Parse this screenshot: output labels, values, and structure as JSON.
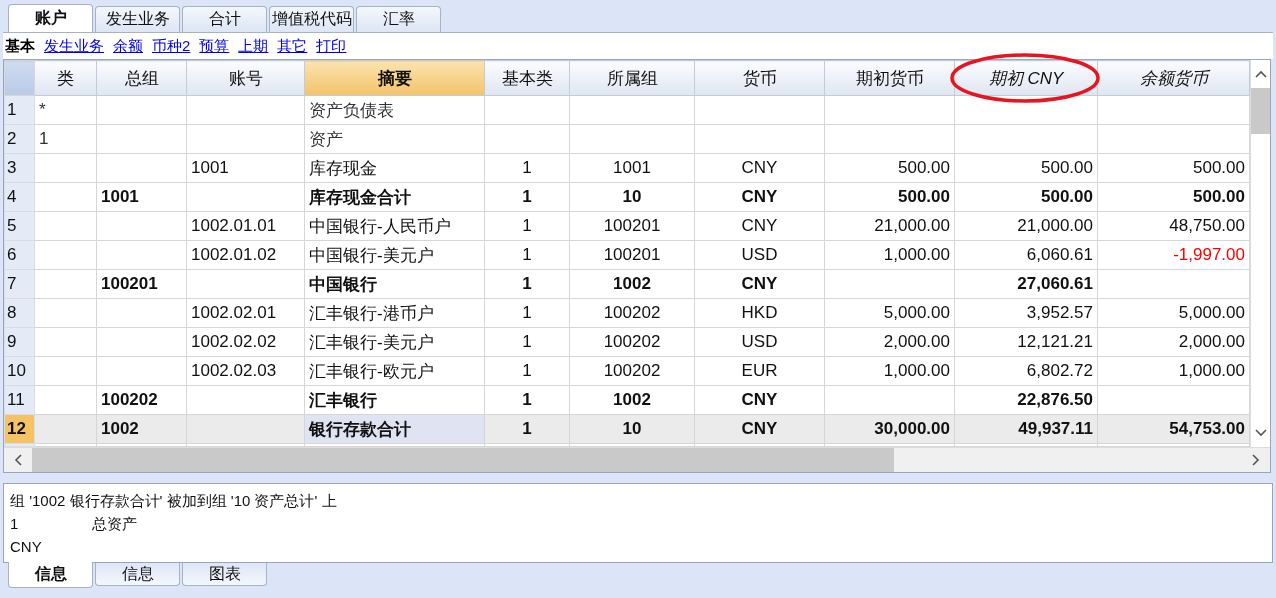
{
  "tabs": [
    {
      "label": "账户",
      "selected": true
    },
    {
      "label": "发生业务",
      "selected": false
    },
    {
      "label": "合计",
      "selected": false
    },
    {
      "label": "增值税代码",
      "selected": false
    },
    {
      "label": "汇率",
      "selected": false
    }
  ],
  "views": [
    {
      "label": "基本",
      "selected": true
    },
    {
      "label": "发生业务",
      "selected": false
    },
    {
      "label": "余额",
      "selected": false
    },
    {
      "label": "币种2",
      "selected": false
    },
    {
      "label": "预算",
      "selected": false
    },
    {
      "label": "上期",
      "selected": false
    },
    {
      "label": "其它",
      "selected": false
    },
    {
      "label": "打印",
      "selected": false
    }
  ],
  "table": {
    "columns": [
      {
        "label": "类",
        "selected": false,
        "italic": false,
        "circled": false
      },
      {
        "label": "总组",
        "selected": false,
        "italic": false,
        "circled": false
      },
      {
        "label": "账号",
        "selected": false,
        "italic": false,
        "circled": false
      },
      {
        "label": "摘要",
        "selected": true,
        "italic": false,
        "circled": false
      },
      {
        "label": "基本类",
        "selected": false,
        "italic": false,
        "circled": false
      },
      {
        "label": "所属组",
        "selected": false,
        "italic": false,
        "circled": false
      },
      {
        "label": "货币",
        "selected": false,
        "italic": false,
        "circled": false
      },
      {
        "label": "期初货币",
        "selected": false,
        "italic": false,
        "circled": false
      },
      {
        "label": "期初 CNY",
        "selected": false,
        "italic": true,
        "circled": true
      },
      {
        "label": "余额货币",
        "selected": false,
        "italic": true,
        "circled": false
      }
    ],
    "rows": [
      {
        "num": "1",
        "kind": "heading",
        "selected": false,
        "negative": false,
        "cells": [
          "*",
          "",
          "",
          "资产负债表",
          "",
          "",
          "",
          "",
          "",
          ""
        ]
      },
      {
        "num": "2",
        "kind": "heading",
        "selected": false,
        "negative": false,
        "cells": [
          "1",
          "",
          "",
          "资产",
          "",
          "",
          "",
          "",
          "",
          ""
        ]
      },
      {
        "num": "3",
        "kind": "account",
        "selected": false,
        "negative": false,
        "cells": [
          "",
          "",
          "1001",
          "库存现金",
          "1",
          "1001",
          "CNY",
          "500.00",
          "500.00",
          "500.00"
        ]
      },
      {
        "num": "4",
        "kind": "total",
        "selected": false,
        "negative": false,
        "cells": [
          "",
          "1001",
          "",
          "库存现金合计",
          "1",
          "10",
          "CNY",
          "500.00",
          "500.00",
          "500.00"
        ]
      },
      {
        "num": "5",
        "kind": "account",
        "selected": false,
        "negative": false,
        "cells": [
          "",
          "",
          "1002.01.01",
          "中国银行-人民币户",
          "1",
          "100201",
          "CNY",
          "21,000.00",
          "21,000.00",
          "48,750.00"
        ]
      },
      {
        "num": "6",
        "kind": "account",
        "selected": false,
        "negative": true,
        "cells": [
          "",
          "",
          "1002.01.02",
          "中国银行-美元户",
          "1",
          "100201",
          "USD",
          "1,000.00",
          "6,060.61",
          "-1,997.00"
        ]
      },
      {
        "num": "7",
        "kind": "total",
        "selected": false,
        "negative": false,
        "cells": [
          "",
          "100201",
          "",
          "中国银行",
          "1",
          "1002",
          "CNY",
          "",
          "27,060.61",
          ""
        ]
      },
      {
        "num": "8",
        "kind": "account",
        "selected": false,
        "negative": false,
        "cells": [
          "",
          "",
          "1002.02.01",
          "汇丰银行-港币户",
          "1",
          "100202",
          "HKD",
          "5,000.00",
          "3,952.57",
          "5,000.00"
        ]
      },
      {
        "num": "9",
        "kind": "account",
        "selected": false,
        "negative": false,
        "cells": [
          "",
          "",
          "1002.02.02",
          "汇丰银行-美元户",
          "1",
          "100202",
          "USD",
          "2,000.00",
          "12,121.21",
          "2,000.00"
        ]
      },
      {
        "num": "10",
        "kind": "account",
        "selected": false,
        "negative": false,
        "cells": [
          "",
          "",
          "1002.02.03",
          "汇丰银行-欧元户",
          "1",
          "100202",
          "EUR",
          "1,000.00",
          "6,802.72",
          "1,000.00"
        ]
      },
      {
        "num": "11",
        "kind": "total",
        "selected": false,
        "negative": false,
        "cells": [
          "",
          "100202",
          "",
          "汇丰银行",
          "1",
          "1002",
          "CNY",
          "",
          "22,876.50",
          ""
        ]
      },
      {
        "num": "12",
        "kind": "total",
        "selected": true,
        "negative": false,
        "cells": [
          "",
          "1002",
          "",
          "银行存款合计",
          "1",
          "10",
          "CNY",
          "30,000.00",
          "49,937.11",
          "54,753.00"
        ]
      }
    ]
  },
  "info": {
    "message": "组 '1002 银行存款合计' 被加到组 '10 资产总计' 上",
    "lines": [
      [
        "1",
        "总资产"
      ],
      [
        "CNY"
      ]
    ]
  },
  "bottom_tabs": [
    {
      "label": "信息",
      "selected": true
    },
    {
      "label": "信息",
      "selected": false
    },
    {
      "label": "图表",
      "selected": false
    }
  ]
}
